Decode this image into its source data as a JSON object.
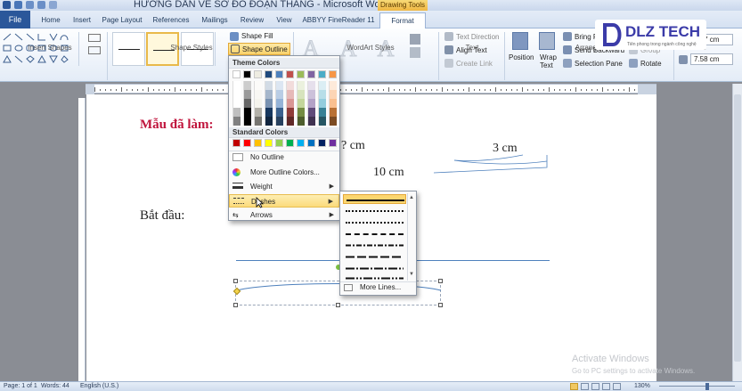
{
  "window": {
    "title": "HƯỚNG DẪN VẼ SƠ ĐỒ ĐOẠN THẲNG - Microsoft Word",
    "contextual_tab_group": "Drawing Tools"
  },
  "tabs": [
    {
      "label": "File"
    },
    {
      "label": "Home"
    },
    {
      "label": "Insert"
    },
    {
      "label": "Page Layout"
    },
    {
      "label": "References"
    },
    {
      "label": "Mailings"
    },
    {
      "label": "Review"
    },
    {
      "label": "View"
    },
    {
      "label": "ABBYY FineReader 11"
    },
    {
      "label": "Format"
    }
  ],
  "ribbon": {
    "groups": {
      "insert_shapes": "Insert Shapes",
      "shape_styles": "Shape Styles",
      "wordart_styles": "WordArt Styles",
      "text": "Text",
      "arrange": "Arrange",
      "size": "Size"
    },
    "shape_fill": "Shape Fill",
    "shape_outline": "Shape Outline",
    "text_direction": "Text Direction",
    "align_text": "Align Text",
    "create_link": "Create Link",
    "position": "Position",
    "wrap_text_1": "Wrap",
    "wrap_text_2": "Text",
    "bring_forward": "Bring Fo...",
    "send_backward": "Send Backward",
    "selection_pane": "Selection Pane",
    "group": "Group",
    "rotate": "Rotate",
    "height": "0.97 cm",
    "width": "7.58 cm",
    "wordart_letter": "A"
  },
  "logo": {
    "brand": "DLZ TECH",
    "tagline": "Tiên phong trong ngành công nghệ"
  },
  "outline_menu": {
    "theme_colors_header": "Theme Colors",
    "standard_colors_header": "Standard Colors",
    "no_outline": "No Outline",
    "more_colors": "More Outline Colors...",
    "weight": "Weight",
    "dashes": "Dashes",
    "arrows": "Arrows",
    "theme_top_row": [
      "#ffffff",
      "#000000",
      "#eeece1",
      "#1f497d",
      "#4f81bd",
      "#c0504d",
      "#9bbb59",
      "#8064a2",
      "#4bacc6",
      "#f79646"
    ],
    "standard_colors": [
      "#c00000",
      "#ff0000",
      "#ffc000",
      "#ffff00",
      "#92d050",
      "#00b050",
      "#00b0f0",
      "#0070c0",
      "#002060",
      "#7030a0"
    ]
  },
  "dashes_menu": {
    "more_lines": "More Lines...",
    "styles": [
      "solid",
      "round-dot",
      "square-dot",
      "dash",
      "dash-dot",
      "long-dash",
      "long-dash-dot",
      "long-dash-dot-dot"
    ]
  },
  "document": {
    "heading": "Mẫu đã làm:",
    "start_label": "Bắt đầu:",
    "label_unknown": "? cm",
    "label_3cm": "3 cm",
    "label_10cm": "10 cm"
  },
  "status_bar": {
    "page": "Page: 1 of 1",
    "words": "Words: 44",
    "language": "English (U.S.)",
    "zoom": "130%"
  },
  "watermark": {
    "line1": "Activate Windows",
    "line2": "Go to PC settings to activate Windows."
  }
}
